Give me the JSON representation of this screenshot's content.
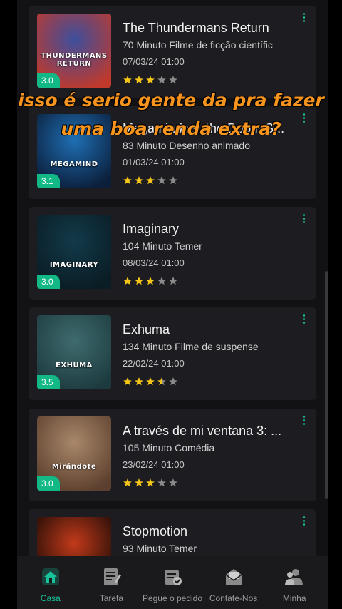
{
  "caption": {
    "line1": "isso é serio gente da pra fazer",
    "line2": "uma boa renda extra?",
    "color": "#f7941d"
  },
  "movies": [
    {
      "title": "The Thundermans Return",
      "meta": "70 Minuto Filme de ficção científic",
      "date": "07/03/24 01:00",
      "rating": "3.0",
      "stars": 3,
      "poster_text": "THUNDERMANS RETURN",
      "poster_colors": [
        "#3d4f9e",
        "#c0392b"
      ]
    },
    {
      "title": "Megamind vs. the Doom S...",
      "meta": "83 Minuto Desenho animado",
      "date": "01/03/24 01:00",
      "rating": "3.1",
      "stars": 3,
      "poster_text": "MEGAMIND",
      "poster_colors": [
        "#1f6fb4",
        "#0b1e3a"
      ]
    },
    {
      "title": "Imaginary",
      "meta": "104 Minuto Temer",
      "date": "08/03/24 01:00",
      "rating": "3.0",
      "stars": 3,
      "poster_text": "IMAGINARY",
      "poster_colors": [
        "#123a4a",
        "#0a1c24"
      ]
    },
    {
      "title": "Exhuma",
      "meta": "134 Minuto Filme de suspense",
      "date": "22/02/24 01:00",
      "rating": "3.5",
      "stars": 3.5,
      "poster_text": "EXHUMA",
      "poster_colors": [
        "#3e6b6e",
        "#1d3b3f"
      ]
    },
    {
      "title": "A través de mi ventana 3: ...",
      "meta": "105 Minuto Comédia",
      "date": "23/02/24 01:00",
      "rating": "3.0",
      "stars": 3,
      "poster_text": "Mirándote",
      "poster_colors": [
        "#a9886a",
        "#5c3f2e"
      ]
    },
    {
      "title": "Stopmotion",
      "meta": "93 Minuto Temer",
      "date": "",
      "rating": "",
      "stars": 0,
      "poster_text": "",
      "poster_colors": [
        "#c23a1a",
        "#1a0a06"
      ]
    }
  ],
  "tabs": [
    {
      "label": "Casa",
      "icon": "home-icon",
      "active": true
    },
    {
      "label": "Tarefa",
      "icon": "task-icon",
      "active": false
    },
    {
      "label": "Pegue o pedido",
      "icon": "order-icon",
      "active": false
    },
    {
      "label": "Contate-Nos",
      "icon": "mail-icon",
      "active": false
    },
    {
      "label": "Minha",
      "icon": "profile-icon",
      "active": false
    }
  ],
  "colors": {
    "accent": "#17c29a",
    "badge": "#12b886",
    "star_on": "#f5c518",
    "star_off": "#8a8a8a"
  }
}
